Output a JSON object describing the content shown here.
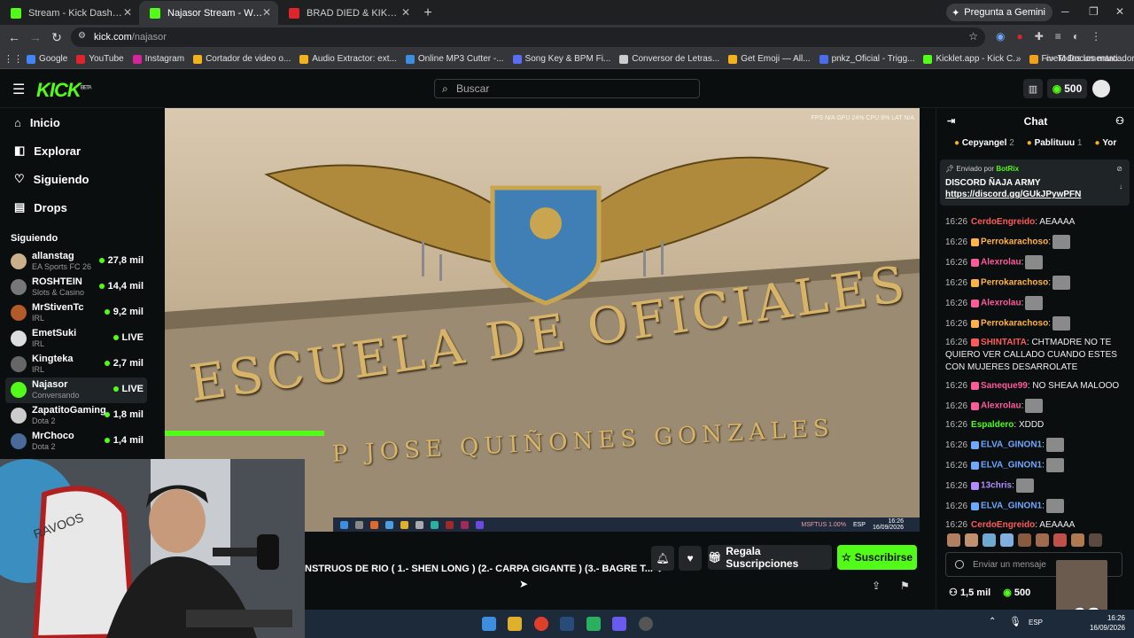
{
  "browser": {
    "tabs": [
      {
        "label": "Stream - Kick Dashboard",
        "color": "#53fc18"
      },
      {
        "label": "Najasor Stream - Watch Live on Kick",
        "color": "#53fc18"
      },
      {
        "label": "BRAD DIED & KIKO CHOSICA -",
        "color": "#e0242c"
      }
    ],
    "gemini_label": "Pregunta a Gemini",
    "url_host": "kick.com",
    "url_path": "/najasor",
    "bookmarks": [
      {
        "label": "Google",
        "color": "#4285f4"
      },
      {
        "label": "YouTube",
        "color": "#e0242c"
      },
      {
        "label": "Instagram",
        "color": "#d6249f"
      },
      {
        "label": "Cortador de video o...",
        "color": "#f2b21c"
      },
      {
        "label": "Audio Extractor: ext...",
        "color": "#f2b21c"
      },
      {
        "label": "Online MP3 Cutter -...",
        "color": "#3d8de0"
      },
      {
        "label": "Song Key & BPM Fi...",
        "color": "#5b6df0"
      },
      {
        "label": "Conversor de Letras...",
        "color": "#cccccc"
      },
      {
        "label": "Get Emoji — All...",
        "color": "#f2b21c"
      },
      {
        "label": "pnkz_Oficial - Trigg...",
        "color": "#4a6df0"
      },
      {
        "label": "Kicklet.app - Kick C...",
        "color": "#53fc18"
      },
      {
        "label": "FiveM Documentati...",
        "color": "#f29f1c"
      }
    ],
    "all_bookmarks": "Todos los marcadores"
  },
  "kick": {
    "logo": "KICK",
    "logo_beta": "BETA",
    "search_placeholder": "Buscar",
    "kicks": "500",
    "accent": "#53fc18"
  },
  "sidebar": {
    "nav": [
      {
        "label": "Inicio",
        "icon": "⌂"
      },
      {
        "label": "Explorar",
        "icon": "◧"
      },
      {
        "label": "Siguiendo",
        "icon": "♡"
      },
      {
        "label": "Drops",
        "icon": "▤"
      }
    ],
    "section": "Siguiendo",
    "following": [
      {
        "name": "allanstag",
        "cat": "EA Sports FC 26",
        "viewers": "27,8 mil",
        "color": "#c9b08a"
      },
      {
        "name": "ROSHTEIN",
        "cat": "Slots & Casino",
        "viewers": "14,4 mil",
        "color": "#777777"
      },
      {
        "name": "MrStivenTc",
        "cat": "IRL",
        "viewers": "9,2 mil",
        "color": "#b35a2a"
      },
      {
        "name": "EmetSuki",
        "cat": "IRL",
        "viewers": "LIVE",
        "color": "#dddddd"
      },
      {
        "name": "Kingteka",
        "cat": "IRL",
        "viewers": "2,7 mil",
        "color": "#666666"
      },
      {
        "name": "Najasor",
        "cat": "Conversando",
        "viewers": "LIVE",
        "color": "#53fc18"
      },
      {
        "name": "ZapatitoGaming",
        "cat": "Dota 2",
        "viewers": "1,8 mil",
        "color": "#cccccc"
      },
      {
        "name": "MrChoco",
        "cat": "Dota 2",
        "viewers": "1,4 mil",
        "color": "#4a6a9a"
      }
    ]
  },
  "video": {
    "overlay": "FPS N/A   GPU 24%   CPU 8%   LAT N/A",
    "sign_line1": "ESCUELA DE OFICIALES",
    "sign_line2": "P JOSE QUIÑONES GONZALES",
    "tray": "MSFTUS  1.00%",
    "tray_time": "16:26",
    "tray_date": "16/09/2026",
    "tray_lang": "ESP"
  },
  "stream": {
    "title": "NSTRUOS DE RIO   ( 1.- SHEN LONG )  (2.- CARPA GIGANTE )  (3.- BAGRE T...",
    "gift_label": "Regala Suscripciones",
    "subscribe_label": "Suscribirse"
  },
  "chat": {
    "title": "Chat",
    "gifters": [
      {
        "name": "Cepyangel",
        "count": "2"
      },
      {
        "name": "Pablituuu",
        "count": "1"
      },
      {
        "name": "Yor",
        "count": ""
      }
    ],
    "pinned_by_prefix": "Enviado por",
    "pinned_by": "BotRix",
    "pinned_text": "DISCORD ÑAJA ARMY",
    "pinned_link": "https://discord.gg/GUkJPywPFN",
    "messages": [
      {
        "time": "16:26",
        "user": "CerdoEngreido",
        "color": "#ff5a5a",
        "badge": "",
        "text": ": AEAAAA",
        "emote": false
      },
      {
        "time": "16:26",
        "user": "Perrokarachoso",
        "color": "#ffb347",
        "badge": "37",
        "text": ":",
        "emote": true
      },
      {
        "time": "16:26",
        "user": "Alexrolau",
        "color": "#ff5a9a",
        "badge": "45",
        "text": ":",
        "emote": true
      },
      {
        "time": "16:26",
        "user": "Perrokarachoso",
        "color": "#ffb347",
        "badge": "37",
        "text": ":",
        "emote": true
      },
      {
        "time": "16:26",
        "user": "Alexrolau",
        "color": "#ff5a9a",
        "badge": "45",
        "text": ":",
        "emote": true
      },
      {
        "time": "16:26",
        "user": "Perrokarachoso",
        "color": "#ffb347",
        "badge": "37",
        "text": ":",
        "emote": true
      },
      {
        "time": "16:26",
        "user": "SHINTAITA",
        "color": "#ff5a5a",
        "badge": "25",
        "text": ": CHTMADRE NO TE QUIERO VER CALLADO CUANDO ESTES CON MUJERES DESARROLATE",
        "emote": false
      },
      {
        "time": "16:26",
        "user": "Saneque99",
        "color": "#ff5a9a",
        "badge": "23",
        "text": ": NO SHEAA MALOOO",
        "emote": false
      },
      {
        "time": "16:26",
        "user": "Alexrolau",
        "color": "#ff5a9a",
        "badge": "45",
        "text": ":",
        "emote": true
      },
      {
        "time": "16:26",
        "user": "Espaldero",
        "color": "#53fc18",
        "badge": "",
        "text": ": XDDD",
        "emote": false
      },
      {
        "time": "16:26",
        "user": "ELVA_GINON1",
        "color": "#6fa8ff",
        "badge": "21",
        "text": ":",
        "emote": true
      },
      {
        "time": "16:26",
        "user": "ELVA_GINON1",
        "color": "#6fa8ff",
        "badge": "21",
        "text": ":",
        "emote": true
      },
      {
        "time": "16:26",
        "user": "13chris",
        "color": "#b48cff",
        "badge": "40",
        "text": ":",
        "emote": true
      },
      {
        "time": "16:26",
        "user": "ELVA_GINON1",
        "color": "#6fa8ff",
        "badge": "21",
        "text": ":",
        "emote": true
      },
      {
        "time": "16:26",
        "user": "CerdoEngreido",
        "color": "#ff5a5a",
        "badge": "",
        "text": ": AEAAAA",
        "emote": false
      }
    ],
    "input_placeholder": "Enviar un mensaje",
    "viewers": "1,5 mil",
    "kicks": "500"
  },
  "overlay_badge": "x92",
  "taskbar": {
    "lang": "ESP",
    "time": "16:26",
    "date": "16/09/2026"
  }
}
